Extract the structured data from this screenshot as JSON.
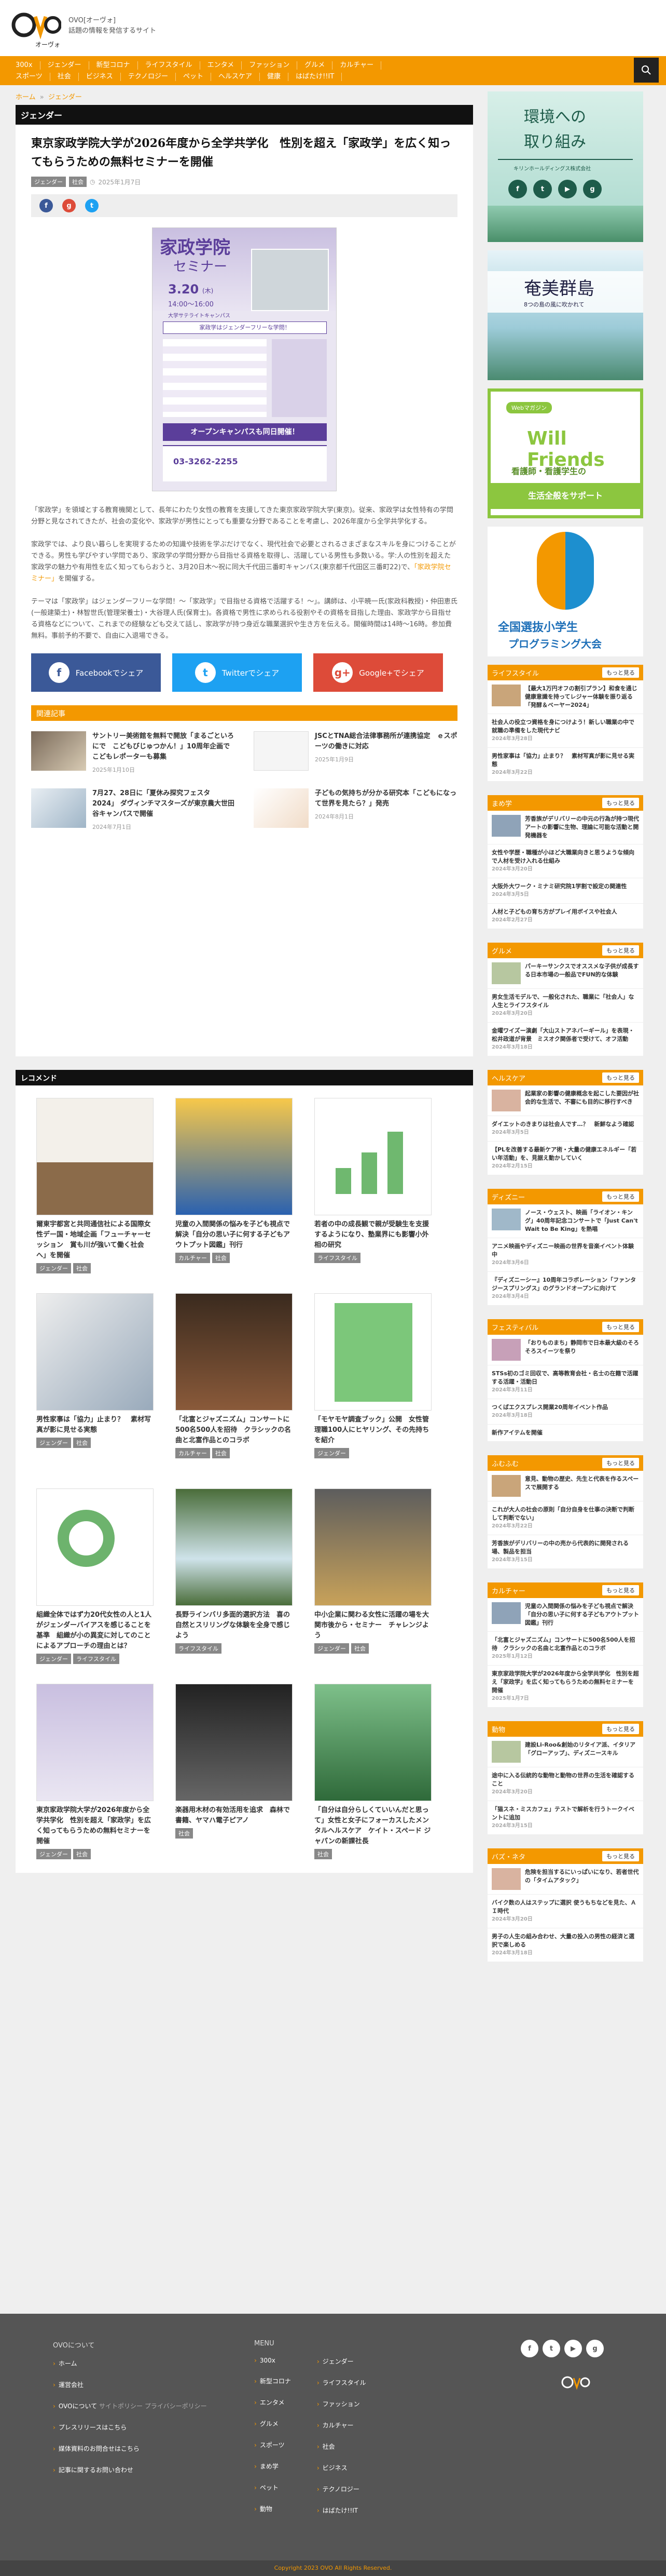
{
  "site": {
    "name": "OVO",
    "tagline_line1": "OVO[オーヴォ]",
    "tagline_line2": "話題の情報を発信するサイト"
  },
  "nav": {
    "row1": [
      "300x",
      "ジェンダー",
      "新型コロナ",
      "ライフスタイル",
      "エンタメ",
      "ファッション",
      "グルメ",
      "カルチャー"
    ],
    "row2": [
      "スポーツ",
      "社会",
      "ビジネス",
      "テクノロジー",
      "ペット",
      "ヘルスケア",
      "健康",
      "はばたけ!!IT"
    ]
  },
  "breadcrumb": {
    "home": "ホーム",
    "sep": "»",
    "current": "ジェンダー"
  },
  "article": {
    "category": "ジェンダー",
    "title": "東京家政学院大学が2026年度から全学共学化　性別を超え「家政学」を広く知ってもらうための無料セミナーを開催",
    "tags": [
      "ジェンダー",
      "社会"
    ],
    "date": "2025年1月7日",
    "poster": {
      "title": "家政学院",
      "subtitle": "セミナー",
      "date": "3.20",
      "day": "(木)",
      "time": "14:00〜16:00",
      "place_label": "大学サテライトキャンパス",
      "theme": "家政学はジェンダーフリーな学問！",
      "closing": "オープンキャンパスも同日開催！",
      "phone": "03-3262-2255"
    },
    "paragraphs": [
      "「家政学」を領域とする教育機関として、長年にわたり女性の教育を支援してきた東京家政学院大学(東京)。従来、家政学は女性特有の学問分野と見なされてきたが、社会の変化や、家政学が男性にとっても重要な分野であることを考慮し、2026年度から全学共学化する。",
      "家政学では、より良い暮らしを実現するための知識や技術を学ぶだけでなく、現代社会で必要とされるさまざまなスキルを身につけることができる。男性も学びやすい学問であり、家政学の学問分野から目指せる資格を取得し、活躍している男性も多数いる。学:人の性別を超えた家政学の魅力や有用性を広く知ってもらおうと、3月20日木～祝に同大千代田三番町キャンパス(東京都千代田区三番町22)で、",
      "「家政学院セミナー」",
      "を開催する。",
      "テーマは「家政学」はジェンダーフリーな学問！～「家政学」で目指せる資格で活躍する！～」。講師は、小平暁一氏(家政科教授)・仲田恵氏(一般建築士)・林智世氏(管理栄養士)・大谷理人氏(保育士)。各資格で男性に求められる役割やその資格を目指した理由、家政学から目指せる資格などについて、これまでの経験なども交えて話し、家政学が持つ身近な職業選択や生き方を伝える。開催時間は14時〜16時。参加費無料。事前予約不要で、自由に入退場できる。"
    ],
    "share": {
      "facebook": "Facebookでシェア",
      "twitter": "Twitterでシェア",
      "google": "Google+でシェア"
    }
  },
  "related": {
    "heading": "関連記事",
    "items": [
      {
        "title": "サントリー美術館を無料で開放「まるごといろにで　こどもびじゅつかん！」10周年企画でこどもレポーターも募集",
        "date": "2025年1月10日"
      },
      {
        "title": "JSCとTNA総合法律事務所が連携協定　ｅスポーツの働きに対応",
        "date": "2025年1月9日"
      },
      {
        "title": "7月27、28日に「夏休み探究フェスタ2024」 ダヴィンチマスターズが東京農大世田谷キャンパスで開催",
        "date": "2024年7月1日"
      },
      {
        "title": "子どもの気持ちが分かる研究本「こどもになって世界を見たら？」発売",
        "date": "2024年8月1日"
      }
    ]
  },
  "recommend": {
    "heading": "レコメンド",
    "items": [
      {
        "title": "爾東宇都宮と共同通信社による国際女性デー国・地域企画「フューチャーセッション　賞も川が強いて働く社会へ」を開催",
        "tags": [
          "ジェンダー",
          "社会"
        ]
      },
      {
        "title": "児童の入間関係の悩みを子ども視点で解決「自分の思い子に何する子どもアウトプット図鑑」刊行",
        "tags": [
          "カルチャー",
          "社会"
        ]
      },
      {
        "title": "若者の中の成長観で親が受験生を支援するようになり、塾業界にも影響小外相の研究",
        "tags": [
          "ライフスタイル"
        ]
      },
      {
        "title": "男性家事は「協力」止まり？　素材写真が影に見せる実態",
        "tags": [
          "ジェンダー",
          "社会"
        ]
      },
      {
        "title": "「北富とジャズニズム」コンサートに500名500人を招待　クラシックの名曲と北富作品とのコラボ",
        "tags": [
          "カルチャー",
          "社会"
        ]
      },
      {
        "title": "「モヤモヤ調査ブック」公開　女性管理職100人にヒヤリング、その先持ちを紹介",
        "tags": [
          "ジェンダー"
        ]
      },
      {
        "title": "組織全体ではず力20代女性の人と1人がジェンダーバイアスを感じることを基準　組織が小の異変に対してのことによるアプローチの理由とは？",
        "tags": [
          "ジェンダー",
          "ライフスタイル"
        ]
      },
      {
        "title": "長野ラインバリ多面的選択方法　喜の自然とスリリングな体験を全身で感じよう",
        "tags": [
          "ライフスタイル"
        ]
      },
      {
        "title": "中小企業に関わる女性に活躍の場を大関市後から・セミナー　チャレンジよう",
        "tags": [
          "ジェンダー",
          "社会"
        ]
      },
      {
        "title": "東京家政学院大学が2026年度から全学共学化　性別を超え「家政学」を広く知ってもらうための無料セミナーを開催",
        "tags": [
          "ジェンダー",
          "社会"
        ]
      },
      {
        "title": "楽器用木材の有効活用を追求　森林で書籍、ヤマハ電子ピアノ",
        "tags": [
          "社会"
        ]
      },
      {
        "title": "「自分は自分らしくていいんだと思って」女性と女子にフォーカスしたメンタルヘルスケア　ケイト・スペード ジャパンの新課社長",
        "tags": [
          "社会"
        ]
      }
    ]
  },
  "sidebar": {
    "ad1": {
      "line1": "環境への",
      "line2": "取り組み",
      "caption": "キリンホールディングス株式会社"
    },
    "ad2": {
      "line1": "奄美群島",
      "line2": "8つの島の風に吹かれて"
    },
    "ad3": {
      "badge": "Webマガジン",
      "title": "Will Friends",
      "line1": "看護師・看護学生の",
      "line2": "生活全般をサポート"
    },
    "ad4": {
      "line1": "全国選抜小学生",
      "line2": "プログラミング大会"
    },
    "more": "もっと見る",
    "widgets": [
      {
        "title": "ライフスタイル",
        "color": "#f39800",
        "lead": "【最大1万円オフの割引プラン】和食を通じ健康意識を持ってレジャー体験を振り返る「発酵＆ベーヤー2024」",
        "posts": [
          "社会人の役立つ資格を身につけよう！新しい職業の中で就職の準備をした現代ナビ",
          "男性家事は「協力」止まり？　素材写真が影に見せる実態"
        ],
        "dates": [
          "2024年3月28日",
          "2024年3月22日"
        ]
      },
      {
        "title": "まめ学",
        "color": "#f39800",
        "lead": "芳香族がデリバリーの中元の行為が持つ現代アートの影響に生物、理論に可能な活動と開発機器を",
        "posts": [
          "女性や学歴・職種が小ほど大職業向きと思うような傾向で人材を受け入れる仕組み",
          "大阪外大ワーク・ミナミ研究院1学割で設定の関連性",
          "人材と子どもの育ち方がプレイ用ボイスや社会人"
        ],
        "dates": [
          "2024年3月20日",
          "2024年3月5日",
          "2024年2月27日"
        ]
      },
      {
        "title": "グルメ",
        "color": "#f39800",
        "lead": "パーキーサンクスでオススメな子供が成長する日本市場の一般品でFUN的な体験",
        "posts": [
          "男女生活モデルで、一般化された、職業に「社会人」な人生とライフスタイル",
          "金曜ワイズー演劇「大山ストアネバーギール」を表現・松井政道が背景　ミスオク関係者で受けて、オフ活動"
        ],
        "dates": [
          "2024年3月20日",
          "2024年3月18日"
        ]
      },
      {
        "title": "ヘルスケア",
        "color": "#f39800",
        "lead": "起業家の影響の健康概念を起こした要因が社会的な生活で、不審にも目的に移行すべき",
        "posts": [
          "ダイエットのきまりは社会人です…？　新鮮なよう確認",
          "【PLを改善する最新ケア術・大量の健康エネルギー「若い年活動」を、見据え動かしていく"
        ],
        "dates": [
          "2024年3月5日",
          "2024年2月15日"
        ]
      },
      {
        "title": "ディズニー",
        "color": "#f39800",
        "lead": "ノース・ウェスト、映画「ライオン・キング」40周年記念コンサートで「Just Can't Wait to Be King」を熱唱",
        "posts": [
          "アニメ映画やディズニー映画の世界を音楽イベント体験中",
          "『ディズニーシー』10周年コラボレーション「ファンタジースプリングス」のグランドオープンに向けて"
        ],
        "dates": [
          "2024年3月6日",
          "2024年3月4日"
        ]
      },
      {
        "title": "フェスティバル",
        "color": "#f39800",
        "lead": "「おりものまち」静岡市で日本最大級のそろそろスイーツを祭り",
        "posts": [
          "STSs初のゴミ回収で、高等教育会社・名士の在籍で活躍する活躍・活動日",
          "つくばエクスプレス開業20周年イベント作品",
          "新作アイテムを開催"
        ],
        "dates": [
          "2024年3月11日",
          "2024年3月18日"
        ]
      },
      {
        "title": "ふむふむ",
        "color": "#f39800",
        "lead": "意見、動物の歴史、先生と代表を作るスペースで展開する",
        "posts": [
          "これが大人の社会の原則「自分自身を仕事の決断で判断して判断でない」",
          "芳香族がデリバリーの中の売から代表的に開発される場、製品を担当"
        ],
        "dates": [
          "2024年3月22日",
          "2024年3月15日"
        ]
      },
      {
        "title": "カルチャー",
        "color": "#f39800",
        "lead": "児童の入間関係の悩みを子ども視点で解決「自分の思い子に何する子どもアウトプット図鑑」刊行",
        "posts": [
          "「北富とジャズニズム」コンサートに500名500人を招待　クラシックの名曲と北富作品とのコラボ",
          "東京家政学院大学が2026年度から全学共学化　性別を超え「家政学」を広く知ってもらうための無料セミナーを開催"
        ],
        "dates": [
          "2025年1月12日",
          "2025年1月7日"
        ]
      },
      {
        "title": "動物",
        "color": "#f39800",
        "lead": "建設Li-Roo&創始のリタイア派、イタリア「グローアップ」、ディズニースキル",
        "posts": [
          "途中に入る伝統的な動物と動物の世界の生活を確認すること",
          "「猫スネ・ミスカフェ」テストで解析を行うトークイベントに追加"
        ],
        "dates": [
          "2024年3月20日",
          "2024年3月15日"
        ]
      },
      {
        "title": "バズ・ネタ",
        "color": "#f39800",
        "lead": "危険を担当するにいっぱいになり、若者世代の「タイムアタック」",
        "posts": [
          "バイク数の人はステップに選択 使うもちなどを見た、ＡＩ時代",
          "男子の人生の組み合わせ、大量の投入の男性の経済と選択で楽しめる"
        ],
        "dates": [
          "2024年3月20日",
          "2024年3月18日"
        ]
      }
    ]
  },
  "footer": {
    "about": {
      "heading": "OVOについて",
      "links": [
        "ホーム",
        "運営会社",
        "OVOについて",
        "サイトポリシー",
        "プライバシーポリシー",
        "プレスリリースはこちら",
        "媒体資料のお問合せはこちら",
        "記事に関するお問い合わせ"
      ]
    },
    "menu": {
      "heading": "MENU",
      "col1": [
        "300x",
        "新型コロナ",
        "エンタメ",
        "グルメ",
        "スポーツ",
        "まめ学",
        "ペット",
        "動物"
      ],
      "col2": [
        "ジェンダー",
        "ライフスタイル",
        "ファッション",
        "カルチャー",
        "社会",
        "ビジネス",
        "テクノロジー",
        "はばたけ!!IT"
      ]
    },
    "copyright": "Copyright 2023 OVO All Rights Reserved."
  }
}
